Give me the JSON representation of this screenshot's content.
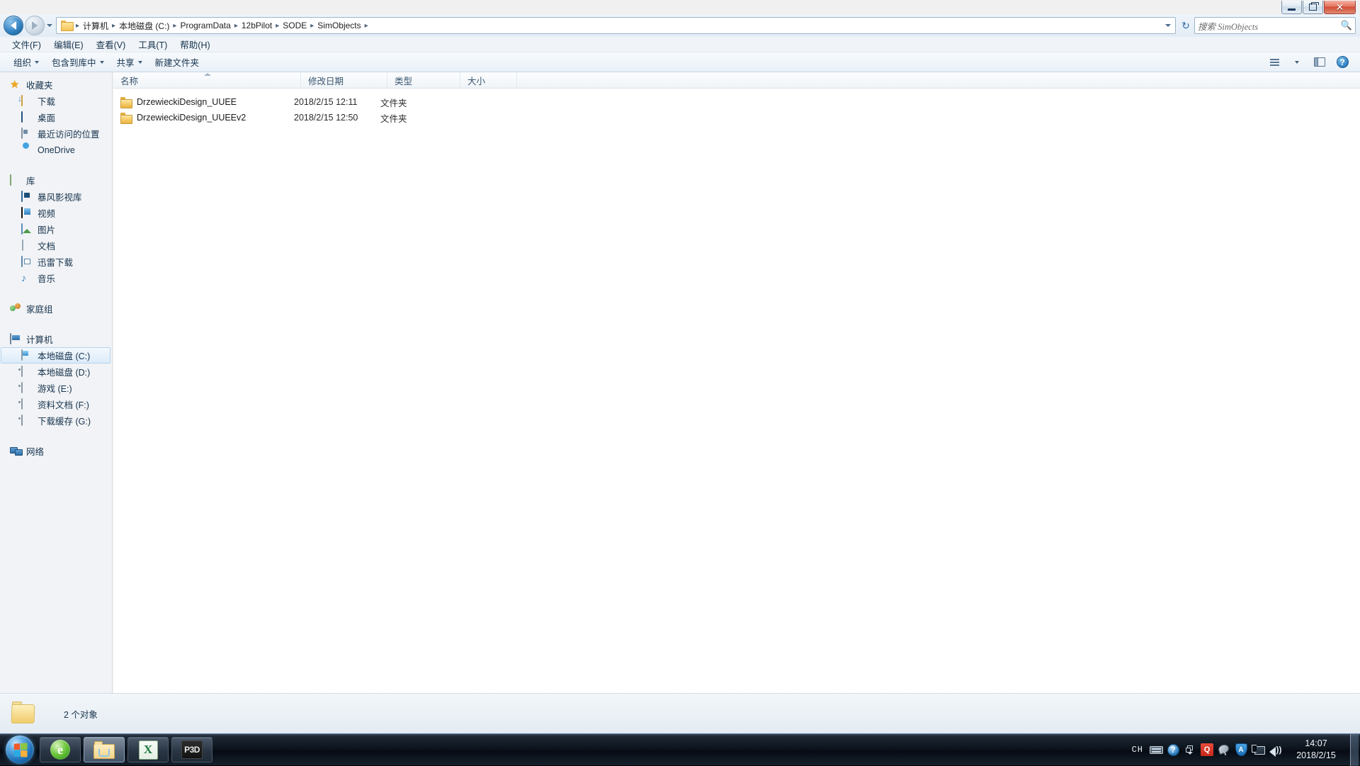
{
  "window": {
    "controls": {
      "minimize": "—",
      "maximize": "❐",
      "close": "✕"
    }
  },
  "background": {
    "browser_tabs_blurred": true
  },
  "address_bar": {
    "back_label": "后退",
    "forward_label": "前进",
    "history_label": "最近访问的位置",
    "folder_icon": "folder-icon",
    "breadcrumbs": [
      "计算机",
      "本地磁盘 (C:)",
      "ProgramData",
      "12bPilot",
      "SODE",
      "SimObjects"
    ],
    "separator": "▸",
    "refresh_label": "刷新",
    "search": {
      "placeholder": "搜索 SimObjects",
      "value": "",
      "icon": "search-icon"
    }
  },
  "menu_bar": {
    "items": [
      {
        "label": "文件(F)"
      },
      {
        "label": "编辑(E)"
      },
      {
        "label": "查看(V)"
      },
      {
        "label": "工具(T)"
      },
      {
        "label": "帮助(H)"
      }
    ]
  },
  "command_bar": {
    "items": [
      {
        "label": "组织",
        "has_caret": true
      },
      {
        "label": "包含到库中",
        "has_caret": true
      },
      {
        "label": "共享",
        "has_caret": true
      },
      {
        "label": "新建文件夹",
        "has_caret": false
      }
    ],
    "right": {
      "view_label": "更改您的视图",
      "preview_label": "显示预览窗格",
      "help_label": "?"
    }
  },
  "nav_pane": {
    "groups": [
      {
        "header": {
          "label": "收藏夹",
          "icon": "star-icon"
        },
        "items": [
          {
            "label": "下载",
            "icon": "download-folder-icon"
          },
          {
            "label": "桌面",
            "icon": "desktop-icon"
          },
          {
            "label": "最近访问的位置",
            "icon": "recent-places-icon"
          },
          {
            "label": "OneDrive",
            "icon": "onedrive-icon"
          }
        ]
      },
      {
        "header": {
          "label": "库",
          "icon": "library-icon"
        },
        "items": [
          {
            "label": "暴风影视库",
            "icon": "baofeng-icon"
          },
          {
            "label": "视频",
            "icon": "video-icon"
          },
          {
            "label": "图片",
            "icon": "pictures-icon"
          },
          {
            "label": "文档",
            "icon": "documents-icon"
          },
          {
            "label": "迅雷下载",
            "icon": "thunder-download-icon"
          },
          {
            "label": "音乐",
            "icon": "music-icon"
          }
        ]
      },
      {
        "header": {
          "label": "家庭组",
          "icon": "homegroup-icon"
        },
        "items": []
      },
      {
        "header": {
          "label": "计算机",
          "icon": "computer-icon"
        },
        "items": [
          {
            "label": "本地磁盘 (C:)",
            "icon": "system-drive-icon",
            "selected": true
          },
          {
            "label": "本地磁盘 (D:)",
            "icon": "drive-icon",
            "selected": false
          },
          {
            "label": "游戏 (E:)",
            "icon": "drive-icon",
            "selected": false
          },
          {
            "label": "资料文档 (F:)",
            "icon": "drive-icon",
            "selected": false
          },
          {
            "label": "下载缓存 (G:)",
            "icon": "drive-icon",
            "selected": false
          }
        ]
      },
      {
        "header": {
          "label": "网络",
          "icon": "network-icon"
        },
        "items": []
      }
    ]
  },
  "file_list": {
    "columns": [
      {
        "label": "名称",
        "sorted": true,
        "sort_dir": "asc"
      },
      {
        "label": "修改日期",
        "sorted": false
      },
      {
        "label": "类型",
        "sorted": false
      },
      {
        "label": "大小",
        "sorted": false
      }
    ],
    "rows": [
      {
        "name": "DrzewieckiDesign_UUEE",
        "date_modified": "2018/2/15 12:11",
        "type": "文件夹",
        "size": "",
        "icon": "folder-icon"
      },
      {
        "name": "DrzewieckiDesign_UUEEv2",
        "date_modified": "2018/2/15 12:50",
        "type": "文件夹",
        "size": "",
        "icon": "folder-icon"
      }
    ]
  },
  "status_bar": {
    "icon": "folder-icon",
    "text": "2 个对象"
  },
  "taskbar": {
    "start_label": "开始",
    "buttons": [
      {
        "label": "360安全浏览器",
        "icon": "green-browser-icon",
        "active": false
      },
      {
        "label": "Windows 资源管理器",
        "icon": "explorer-folder-icon",
        "active": true
      },
      {
        "label": "Microsoft Excel",
        "icon": "excel-icon",
        "active": false
      },
      {
        "label": "Prepar3D",
        "icon": "p3d-icon",
        "active": false
      }
    ],
    "tray": {
      "ime": "CH",
      "icons": [
        {
          "name": "keyboard-icon"
        },
        {
          "name": "help-icon",
          "glyph": "?"
        },
        {
          "name": "show-hidden-icons-icon"
        },
        {
          "name": "qq-icon",
          "glyph": "Q"
        },
        {
          "name": "satellite-icon"
        },
        {
          "name": "antivirus-shield-icon",
          "glyph": "A"
        },
        {
          "name": "network-monitor-icon"
        },
        {
          "name": "volume-icon"
        }
      ],
      "clock": {
        "time": "14:07",
        "date": "2018/2/15"
      },
      "show_desktop_label": "显示桌面"
    }
  },
  "colors": {
    "accent": "#2f7fc0",
    "window_bg": "#f0f0f0",
    "nav_bg": "#f1f3f6",
    "list_bg": "#ffffff",
    "selection": "#dcebf9",
    "taskbar": "#0d141d",
    "folder_yellow": "#f3c45a"
  }
}
